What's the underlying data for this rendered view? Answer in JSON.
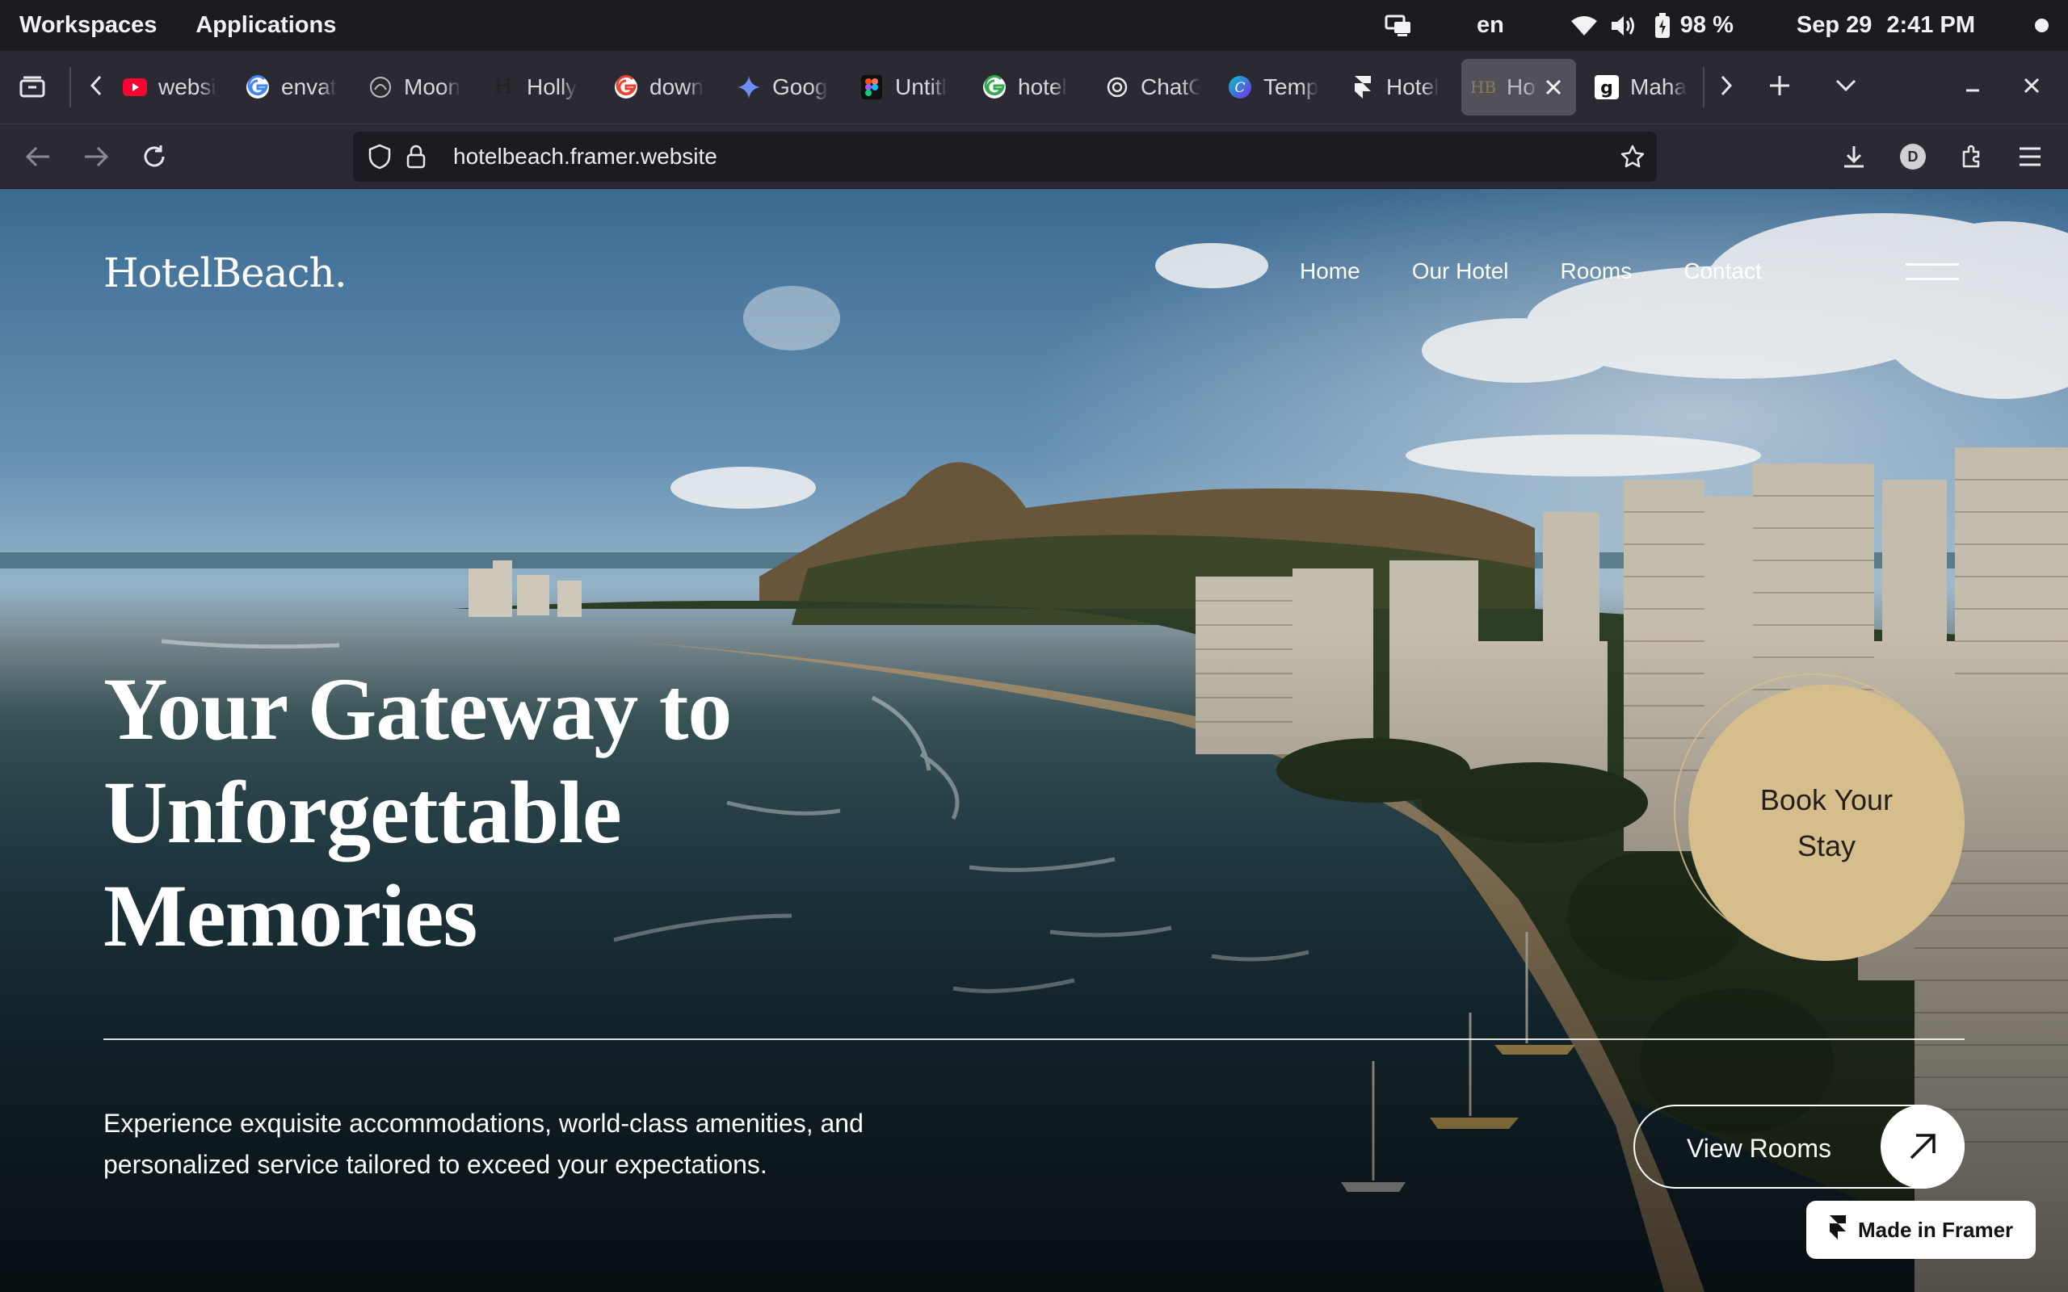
{
  "topbar": {
    "workspaces": "Workspaces",
    "applications": "Applications",
    "language": "en",
    "battery": "98 %",
    "date": "Sep 29",
    "time": "2:41 PM"
  },
  "tabs": [
    {
      "title": "websi",
      "icon": "youtube-icon"
    },
    {
      "title": "envat",
      "icon": "google-icon"
    },
    {
      "title": "Moon",
      "icon": "moon-icon"
    },
    {
      "title": "Holly",
      "icon": "h-logo-icon"
    },
    {
      "title": "down",
      "icon": "google-icon"
    },
    {
      "title": "Goog",
      "icon": "gemini-icon"
    },
    {
      "title": "Untitl",
      "icon": "figma-icon"
    },
    {
      "title": "hotel",
      "icon": "google-icon"
    },
    {
      "title": "ChatG",
      "icon": "openai-icon"
    },
    {
      "title": "Temp",
      "icon": "canva-icon"
    },
    {
      "title": "Hotel",
      "icon": "framer-icon"
    },
    {
      "title": "Hot",
      "icon": "hb-favicon",
      "active": true,
      "favicon_text": "HB"
    },
    {
      "title": "Maha",
      "icon": "gitbook-icon"
    }
  ],
  "address": {
    "url": "hotelbeach.framer.website",
    "profile_initial": "D"
  },
  "site": {
    "logo": "HotelBeach.",
    "nav": [
      "Home",
      "Our Hotel",
      "Rooms",
      "Contact"
    ],
    "headline": [
      "Your Gateway to",
      "Unforgettable",
      "Memories"
    ],
    "book_button": [
      "Book Your",
      "Stay"
    ],
    "description": [
      "Experience exquisite accommodations, world-class amenities, and",
      "personalized service tailored to exceed your expectations."
    ],
    "view_rooms": "View Rooms",
    "made_in_framer": "Made in Framer"
  },
  "colors": {
    "accent_gold": "#d6be8c",
    "browser_chrome": "#2b2a33",
    "system_bar": "#1c1b1f"
  }
}
